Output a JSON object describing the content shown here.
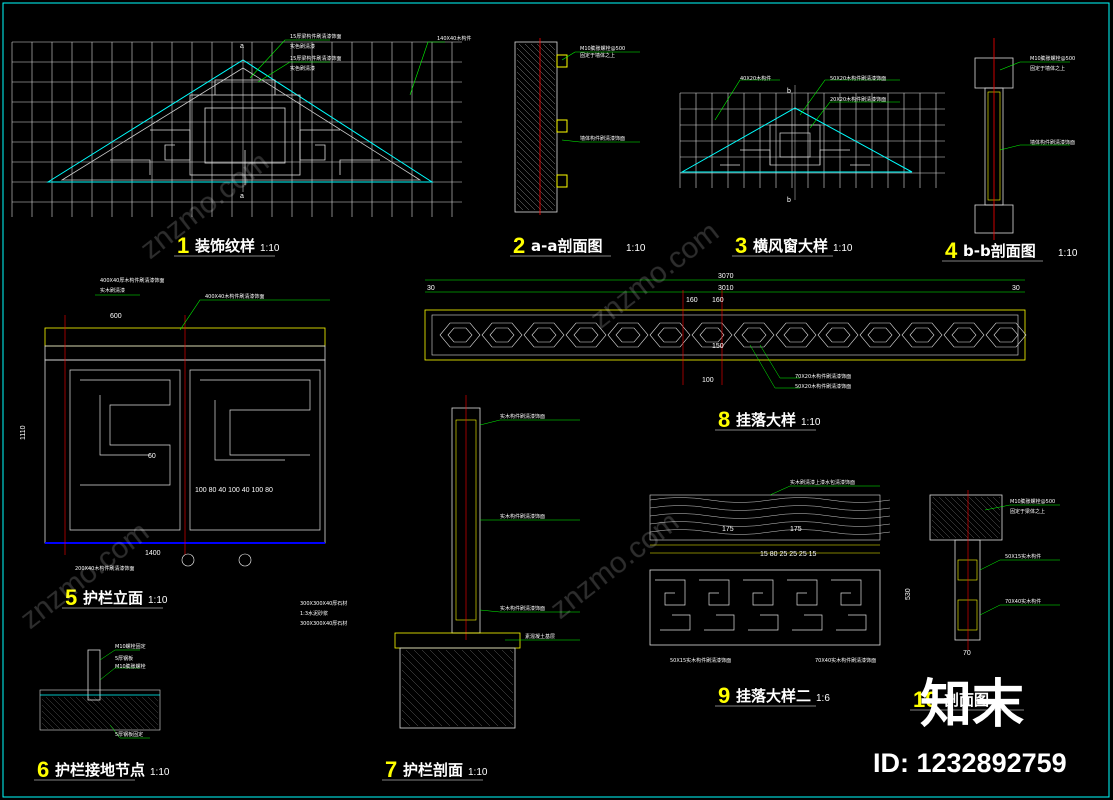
{
  "details": [
    {
      "num": "1",
      "title": "装饰纹样",
      "scale": "1:10"
    },
    {
      "num": "2",
      "title": "a-a剖面图",
      "scale": "1:10"
    },
    {
      "num": "3",
      "title": "横风窗大样",
      "scale": "1:10"
    },
    {
      "num": "4",
      "title": "b-b剖面图",
      "scale": "1:10"
    },
    {
      "num": "5",
      "title": "护栏立面",
      "scale": "1:10"
    },
    {
      "num": "6",
      "title": "护栏接地节点",
      "scale": "1:10"
    },
    {
      "num": "7",
      "title": "护栏剖面",
      "scale": "1:10"
    },
    {
      "num": "8",
      "title": "挂落大样",
      "scale": "1:10"
    },
    {
      "num": "9",
      "title": "挂落大样二",
      "scale": "1:6"
    },
    {
      "num": "10",
      "title": "剖面图",
      "scale": ""
    }
  ],
  "colors": {
    "background": "#000000",
    "frame": "#00ffff",
    "grid": "#ffffff",
    "outline": "#00ffff",
    "leader": "#00ff00",
    "centerline": "#ff0000",
    "dimension": "#ffff00",
    "base": "#0000ff"
  },
  "labels": {
    "d8_dim_total": "3070",
    "d8_dim_inner": "3010",
    "d8_dim_left": "30",
    "d8_dim_right": "30",
    "d8_dim_160a": "160",
    "d8_dim_160b": "160",
    "d8_dim_150": "150",
    "d8_dim_100": "100",
    "d9_dim_175a": "175",
    "d9_dim_175b": "175",
    "d9_dim_row": "15   80    25 25 25 15",
    "d9_dim_530": "530",
    "d10_dim_70": "70",
    "d5_dim_600": "600",
    "d5_dim_1110": "1110",
    "d5_dim_row": "100 80 40 100 40 100 80",
    "d5_dim_cell": "60",
    "d5_dim_1400": "1400"
  },
  "watermark": {
    "text": "znzmo.com",
    "logo": "知末",
    "id": "ID: 1232892759"
  }
}
